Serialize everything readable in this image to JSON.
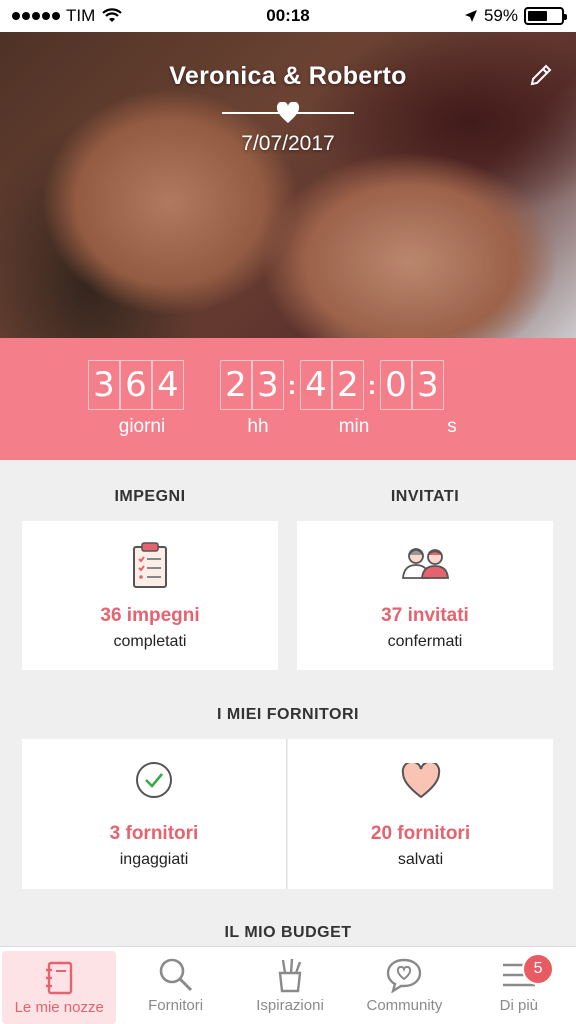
{
  "status_bar": {
    "carrier": "TIM",
    "time": "00:18",
    "battery": "59%",
    "battery_level": 0.59
  },
  "hero": {
    "couple_name": "Veronica & Roberto",
    "wedding_date": "7/07/2017"
  },
  "countdown": {
    "days": [
      "3",
      "6",
      "4"
    ],
    "hours": [
      "2",
      "3"
    ],
    "minutes": [
      "4",
      "2"
    ],
    "seconds": [
      "0",
      "3"
    ],
    "labels": {
      "days": "giorni",
      "hours": "hh",
      "minutes": "min",
      "seconds": "s"
    }
  },
  "impegni": {
    "title": "IMPEGNI",
    "count": "36 impegni",
    "sub": "completati",
    "icon": "clipboard-icon"
  },
  "invitati": {
    "title": "INVITATI",
    "count": "37 invitati",
    "sub": "confermati",
    "icon": "guests-icon"
  },
  "fornitori": {
    "title": "I MIEI FORNITORI",
    "ingaggiati": {
      "count": "3 fornitori",
      "sub": "ingaggiati",
      "icon": "check-circle-icon"
    },
    "salvati": {
      "count": "20 fornitori",
      "sub": "salvati",
      "icon": "heart-icon"
    }
  },
  "budget": {
    "title": "IL MIO BUDGET"
  },
  "tabs": [
    {
      "label": "Le mie nozze",
      "icon": "notebook-icon",
      "active": true
    },
    {
      "label": "Fornitori",
      "icon": "search-icon"
    },
    {
      "label": "Ispirazioni",
      "icon": "brushes-icon"
    },
    {
      "label": "Community",
      "icon": "chat-heart-icon"
    },
    {
      "label": "Di più",
      "icon": "menu-icon",
      "badge": "5"
    }
  ],
  "colors": {
    "accent": "#f47f8b",
    "accent_text": "#e5636f",
    "background": "#efefef"
  }
}
